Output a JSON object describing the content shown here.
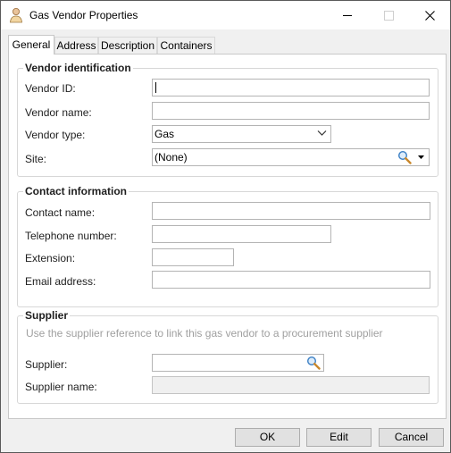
{
  "window": {
    "title": "Gas Vendor Properties"
  },
  "tabs": [
    {
      "label": "General",
      "active": true
    },
    {
      "label": "Address"
    },
    {
      "label": "Description"
    },
    {
      "label": "Containers"
    }
  ],
  "vendor_identification": {
    "title": "Vendor identification",
    "vendor_id_label": "Vendor ID:",
    "vendor_id_value": "",
    "vendor_name_label": "Vendor name:",
    "vendor_name_value": "",
    "vendor_type_label": "Vendor type:",
    "vendor_type_value": "Gas",
    "site_label": "Site:",
    "site_value": "(None)"
  },
  "contact_information": {
    "title": "Contact information",
    "contact_name_label": "Contact name:",
    "telephone_label": "Telephone number:",
    "extension_label": "Extension:",
    "email_label": "Email address:"
  },
  "supplier": {
    "title": "Supplier",
    "hint": "Use the supplier reference to link this gas vendor to a procurement supplier",
    "supplier_label": "Supplier:",
    "supplier_value": "",
    "supplier_name_label": "Supplier name:",
    "supplier_name_value": ""
  },
  "buttons": {
    "ok": "OK",
    "edit": "Edit",
    "cancel": "Cancel"
  },
  "icons": {
    "app": "person-icon",
    "site_lookup": "magnifier-icon",
    "site_dropdown": "dropdown-arrow-icon",
    "supplier_lookup": "magnifier-icon",
    "vendor_type_dropdown": "chevron-down-icon"
  }
}
